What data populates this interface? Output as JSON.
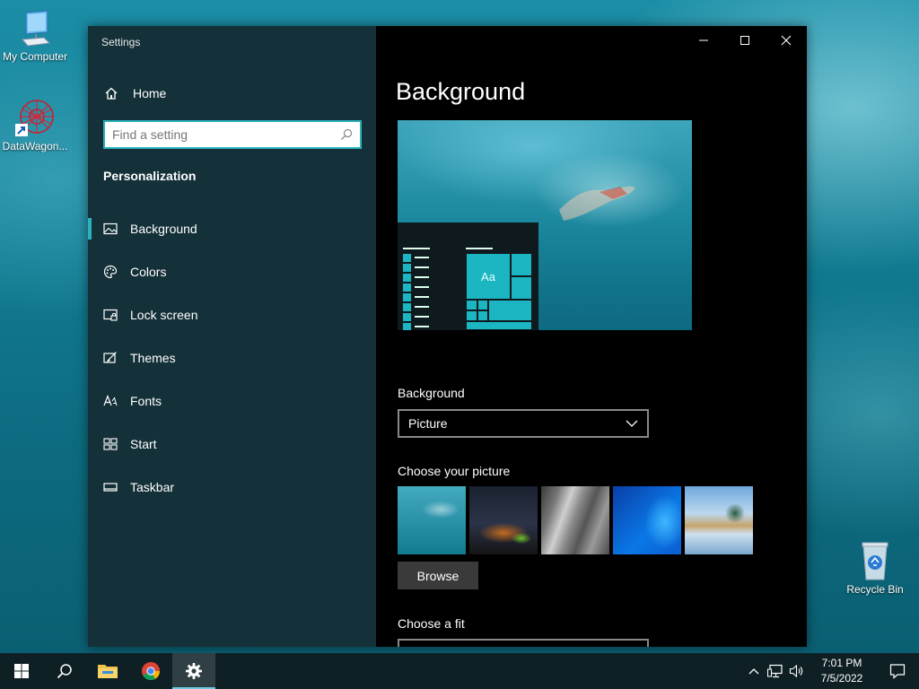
{
  "desktop": {
    "icons": [
      {
        "label": "My Computer"
      },
      {
        "label": "DataWagon..."
      },
      {
        "label": "Recycle Bin"
      }
    ]
  },
  "window": {
    "app_title": "Settings",
    "nav": {
      "home_label": "Home",
      "search_placeholder": "Find a setting",
      "section_title": "Personalization",
      "items": [
        {
          "label": "Background",
          "icon": "picture-icon",
          "active": true
        },
        {
          "label": "Colors",
          "icon": "palette-icon"
        },
        {
          "label": "Lock screen",
          "icon": "lock-screen-icon"
        },
        {
          "label": "Themes",
          "icon": "themes-icon"
        },
        {
          "label": "Fonts",
          "icon": "fonts-icon"
        },
        {
          "label": "Start",
          "icon": "start-icon"
        },
        {
          "label": "Taskbar",
          "icon": "taskbar-icon"
        }
      ]
    },
    "content": {
      "page_title": "Background",
      "preview_sample_text": "Aa",
      "background_label": "Background",
      "background_value": "Picture",
      "choose_picture_label": "Choose your picture",
      "browse_label": "Browse",
      "choose_fit_label": "Choose a fit"
    }
  },
  "taskbar": {
    "time": "7:01 PM",
    "date": "7/5/2022"
  },
  "colors": {
    "accent": "#2bb3bd",
    "tile": "#1cb5c2"
  }
}
